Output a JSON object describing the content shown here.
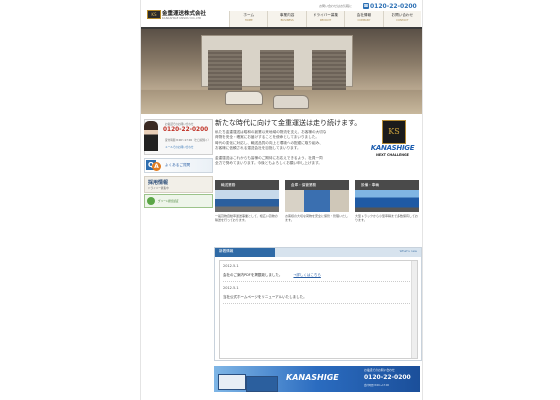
{
  "header": {
    "company_name": "金重運送株式会社",
    "company_name_en": "KANASHIGE UNSOU CO.,LTD",
    "logo_mark": "KS",
    "inquiry_label": "お問い合わせはお気軽に",
    "phone": "0120-22-0200",
    "phone_icon": "phone-icon"
  },
  "nav": {
    "items": [
      {
        "label": "ホーム",
        "en": "HOME"
      },
      {
        "label": "事業内容",
        "en": "BUSINESS"
      },
      {
        "label": "ドライバー募集",
        "en": "RECRUIT"
      },
      {
        "label": "会社情報",
        "en": "COMPANY"
      },
      {
        "label": "お問い合わせ",
        "en": "CONTACT"
      }
    ]
  },
  "sidebar": {
    "contact_label": "お電話でのお問い合わせ",
    "phone": "0120-22-0200",
    "hours": "受付時間 8:00〜17:00（土日祝除く）",
    "mail_label": "メールでのお問い合わせ",
    "qa_label": "よくあるご質問",
    "recruit_label": "採用情報",
    "recruit_sub": "ドライバー募集中",
    "green_label": "グリーン経営認証"
  },
  "main": {
    "heading": "新たな時代に向けて金重運送は走り続けます。",
    "intro_lines": [
      "私たち金重運送は昭和の創業以来地域の物流を支え、お客様の大切な",
      "荷物を安全・確実にお届けすることを使命としてまいりました。",
      "時代の変化に対応し、輸送品質の向上と環境への配慮に取り組み、",
      "お客様に信頼される運送会社を目指してまいります。",
      "金重運送はこれからも皆様のご期待にお応えできるよう、社員一同",
      "全力で努めてまいります。今後ともよろしくお願い申し上げます。"
    ],
    "brand_logo": {
      "mark": "KS",
      "word": "KANASHIGE",
      "tagline": "NEXT CHALLENGE"
    }
  },
  "services": [
    {
      "title": "輸送業務",
      "desc": "一般貨物自動車運送事業として、幅広い貨物の輸送を行っております。"
    },
    {
      "title": "倉庫・保管業務",
      "desc": "お客様の大切な荷物を安全に保管・管理いたします。"
    },
    {
      "title": "設備・車輌",
      "desc": "大型トラックから小型車輌まで多数保有しております。"
    }
  ],
  "news": {
    "title": "新着情報",
    "more": "What's new",
    "items": [
      {
        "date": "2012.5.1",
        "text": "会社のご案内PDFを掲載致しました。",
        "link": "→詳しくはこちら"
      },
      {
        "date": "2012.5.1",
        "text": "当社公式ホームページをリニューアルいたしました。",
        "link": ""
      }
    ]
  },
  "footer_banner": {
    "word": "KANASHIGE",
    "small": "お電話でのお問い合わせ",
    "phone": "0120-22-0200",
    "address": "受付時間 8:00〜17:00"
  },
  "colors": {
    "accent": "#2b6fb4",
    "phone_red": "#c03025",
    "gold": "#b58a2a"
  }
}
